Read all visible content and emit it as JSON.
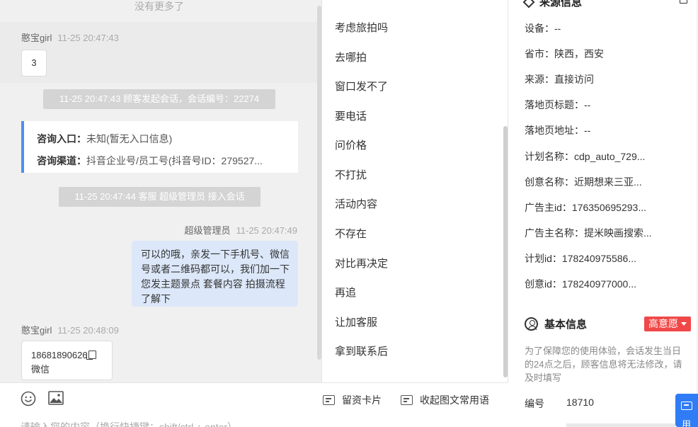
{
  "chat": {
    "no_more": "没有更多了",
    "msg1": {
      "name": "憨宝girl",
      "time": "11-25 20:47:43",
      "text": "3"
    },
    "sys1": "11-25 20:47:43 顾客发起会话，会话编号：22274",
    "consult": {
      "entry_label": "咨询入口：",
      "entry_value": "未知(暂无入口信息)",
      "channel_label": "咨询渠道：",
      "channel_value": "抖音企业号/员工号(抖音号ID：279527..."
    },
    "sys2": "11-25 20:47:44 客服 超级管理员 接入会话",
    "msg2": {
      "name": "超级管理员",
      "time": "11-25 20:47:49",
      "text": "可以的哦，亲发一下手机号、微信号或者二维码都可以，我们加一下您发主题景点 套餐内容 拍摄流程了解下"
    },
    "msg3": {
      "name": "憨宝girl",
      "time": "11-25 20:48:09",
      "phone": "18681890626",
      "sub": "微信"
    }
  },
  "input": {
    "emoji_icon": "smile-icon",
    "image_icon": "image-icon",
    "lead_card": "留资卡片",
    "collapse": "收起图文常用语",
    "placeholder": "请输入您的内容（换行快捷键：shift/ctrl + enter）"
  },
  "quick_replies": [
    "考虑旅拍吗",
    "去哪拍",
    "窗口发不了",
    "要电话",
    "问价格",
    "不打扰",
    "活动内容",
    "不存在",
    "对比再决定",
    "再追",
    "让加客服",
    "拿到联系后"
  ],
  "info": {
    "source_title": "来源信息",
    "device": "设备：--",
    "region": "省市：陕西，西安",
    "source": "来源：直接访问",
    "landing_title": "落地页标题：--",
    "landing_url": "落地页地址：--",
    "plan_name": "计划名称：cdp_auto_729...",
    "creative_name": "创意名称：近期想来三亚...",
    "advertiser_id": "广告主id：176350695293...",
    "advertiser_name": "广告主名称：提米映画搜索...",
    "plan_id": "计划id：178240975586...",
    "creative_id": "创意id：178240977000...",
    "basic_title": "基本信息",
    "intent": "高意愿",
    "notice": "为了保障您的使用体验，会话发生当日的24点之后，顾客信息将无法修改，请及时填写",
    "number_label": "编号",
    "number_value": "18710",
    "float_text": "用"
  }
}
